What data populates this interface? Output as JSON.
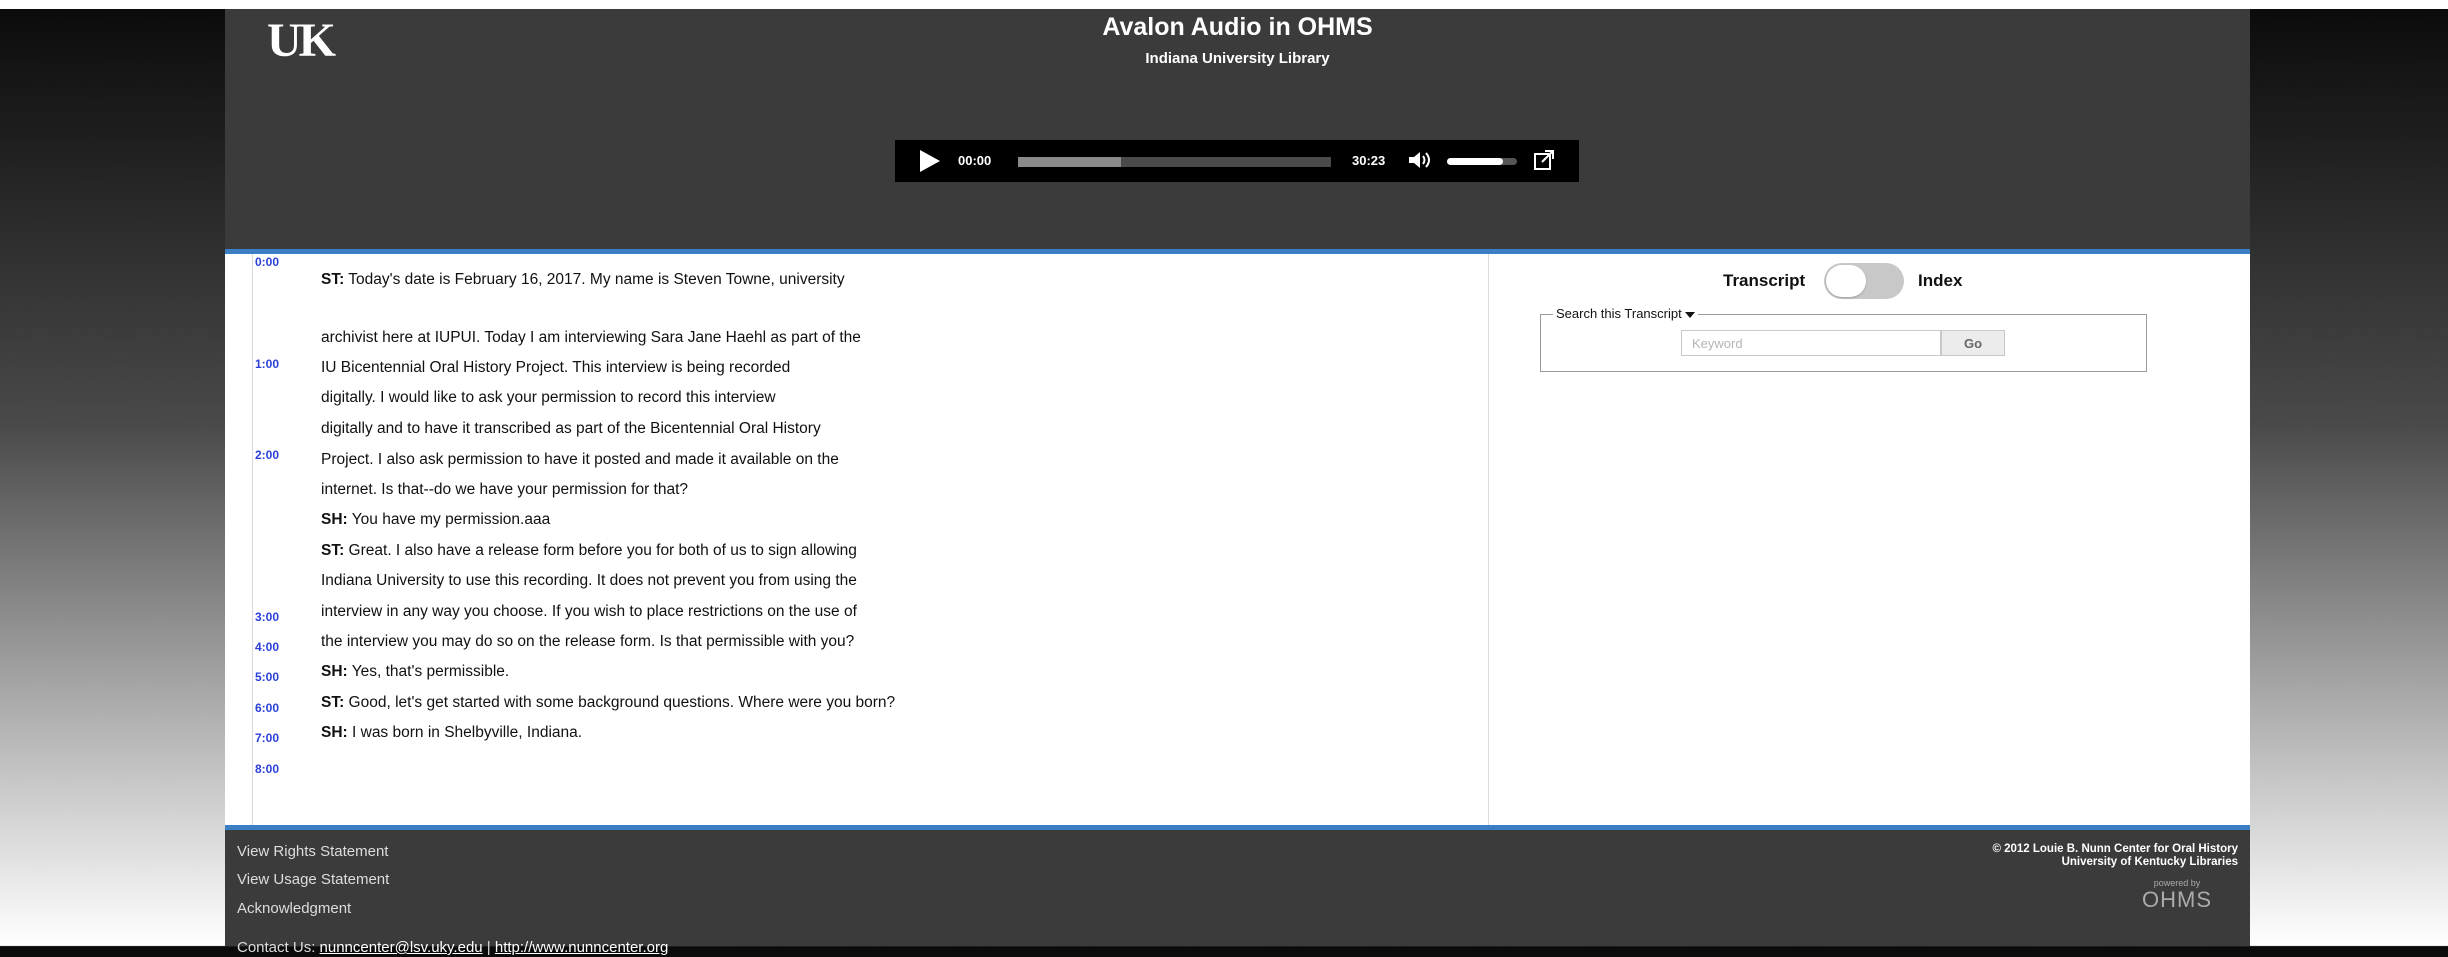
{
  "header": {
    "logo": "UK",
    "title": "Avalon Audio in OHMS",
    "subtitle": "Indiana University Library"
  },
  "player": {
    "current_time": "00:00",
    "total_time": "30:23",
    "progress_fraction": 0.33,
    "volume_fraction": 0.8
  },
  "transcript": {
    "timestamps": [
      "0:00",
      "1:00",
      "2:00",
      "3:00",
      "4:00",
      "5:00",
      "6:00",
      "7:00",
      "8:00"
    ],
    "lines": [
      {
        "speaker": "ST:",
        "text": " Today's date is February 16, 2017. My name is Steven Towne, university"
      },
      {
        "speaker": "",
        "text": "archivist here at IUPUI. Today I am interviewing Sara Jane Haehl as part of the"
      },
      {
        "speaker": "",
        "text": "IU Bicentennial Oral History Project. This interview is being recorded"
      },
      {
        "speaker": "",
        "text": "digitally. I would like to ask your permission to record this interview"
      },
      {
        "speaker": "",
        "text": "digitally and to have it transcribed as part of the Bicentennial Oral History"
      },
      {
        "speaker": "",
        "text": "Project. I also ask permission to have it posted and made it available on the"
      },
      {
        "speaker": "",
        "text": "internet. Is that--do we have your permission for that?"
      },
      {
        "speaker": "SH:",
        "text": " You have my permission.aaa"
      },
      {
        "speaker": "ST:",
        "text": " Great. I also have a release form before you for both of us to sign allowing"
      },
      {
        "speaker": "",
        "text": "Indiana University to use this recording. It does not prevent you from using the"
      },
      {
        "speaker": "",
        "text": "interview in any way you choose. If you wish to place restrictions on the use of"
      },
      {
        "speaker": "",
        "text": "the interview you may do so on the release form. Is that permissible with you?"
      },
      {
        "speaker": "SH:",
        "text": " Yes, that's permissible."
      },
      {
        "speaker": "ST:",
        "text": " Good, let's get started with some background questions. Where were you born?"
      },
      {
        "speaker": "SH:",
        "text": " I was born in Shelbyville, Indiana."
      }
    ]
  },
  "toggle": {
    "left_label": "Transcript",
    "right_label": "Index"
  },
  "search": {
    "legend": "Search this Transcript",
    "placeholder": "Keyword",
    "go_label": "Go"
  },
  "footer": {
    "rights": "View Rights Statement",
    "usage": "View Usage Statement",
    "acknowledgment": "Acknowledgment",
    "contact_label": "Contact Us: ",
    "contact_email": "nunncenter@lsv.uky.edu",
    "contact_separator": " | ",
    "contact_url": "http://www.nunncenter.org",
    "copyright_line1": "© 2012 Louie B. Nunn Center for Oral History",
    "copyright_line2": "University of Kentucky Libraries",
    "powered_by": "powered by",
    "ohms_logo": "OHMS"
  }
}
